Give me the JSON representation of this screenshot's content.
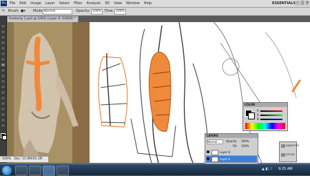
{
  "app": {
    "logo": "Ps",
    "workspace": "ESSENTIALS"
  },
  "menu": [
    "File",
    "Edit",
    "Image",
    "Layer",
    "Select",
    "Filter",
    "Analysis",
    "3D",
    "View",
    "Window",
    "Help"
  ],
  "options": {
    "brush_label": "Brush:",
    "mode_label": "Mode:",
    "mode_value": "Normal",
    "opacity_label": "Opacity:",
    "opacity_value": "100%",
    "flow_label": "Flow:",
    "flow_value": "100%"
  },
  "document": {
    "tab_title": "Anatomy 1.psd @ 100% (Layer 9, RGB/8) *"
  },
  "status": {
    "zoom": "100%",
    "doc": "Doc: 11.9M/45.1M"
  },
  "color_panel": {
    "title": "COLOR",
    "r": "R",
    "g": "G",
    "b": "B"
  },
  "layers_panel": {
    "title": "LAYERS",
    "blend": "Normal",
    "opacity_label": "Opacity:",
    "opacity": "100%",
    "fill_label": "Fill:",
    "fill": "100%",
    "layers": [
      {
        "name": "Layer 8"
      },
      {
        "name": "Layer 9",
        "selected": true
      }
    ]
  },
  "right_dock": {
    "item1": "SWATCHES",
    "item2": "STYLES"
  },
  "taskbar": {
    "time": "9:25 AM"
  }
}
